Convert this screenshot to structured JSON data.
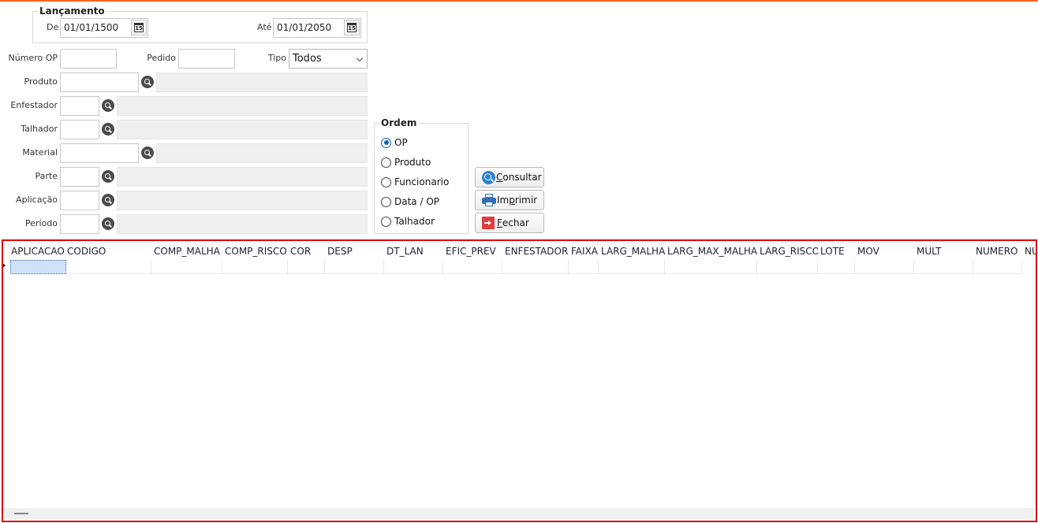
{
  "colors": {
    "accent": "#f26522",
    "grid_border": "#e00000",
    "radio_checked": "#1a5fb4"
  },
  "lancamento": {
    "title": "Lançamento",
    "de_label": "De",
    "de_value": "01/01/1500",
    "ate_label": "Até",
    "ate_value": "01/01/2050",
    "calendar_icon_text": "15"
  },
  "filters": {
    "numero_op_label": "Número OP",
    "numero_op_value": "",
    "pedido_label": "Pedido",
    "pedido_value": "",
    "tipo_label": "Tipo",
    "tipo_value": "Todos",
    "produto_label": "Produto",
    "enfestador_label": "Enfestador",
    "talhador_label": "Talhador",
    "material_label": "Material",
    "parte_label": "Parte",
    "aplicacao_label": "Aplicação",
    "periodo_label": "Período"
  },
  "ordem": {
    "title": "Ordem",
    "options": [
      "OP",
      "Produto",
      "Funcionario",
      "Data / OP",
      "Talhador"
    ],
    "selected": "OP"
  },
  "buttons": {
    "consultar_prefix": "",
    "consultar_accel": "C",
    "consultar_rest": "onsultar",
    "imprimir_prefix": "Im",
    "imprimir_accel": "p",
    "imprimir_rest": "rimir",
    "fechar_prefix": "",
    "fechar_accel": "F",
    "fechar_rest": "echar"
  },
  "grid": {
    "columns": [
      "APLICACAO",
      "CODIGO",
      "COMP_MALHA",
      "COMP_RISCO",
      "COR",
      "DESP",
      "DT_LAN",
      "EFIC_PREV",
      "ENFESTADOR",
      "FAIXA",
      "LARG_MALHA",
      "LARG_MAX_MALHA",
      "LARG_RISCO",
      "LOTE",
      "MOV",
      "MULT",
      "NUMERO",
      "NU"
    ]
  }
}
